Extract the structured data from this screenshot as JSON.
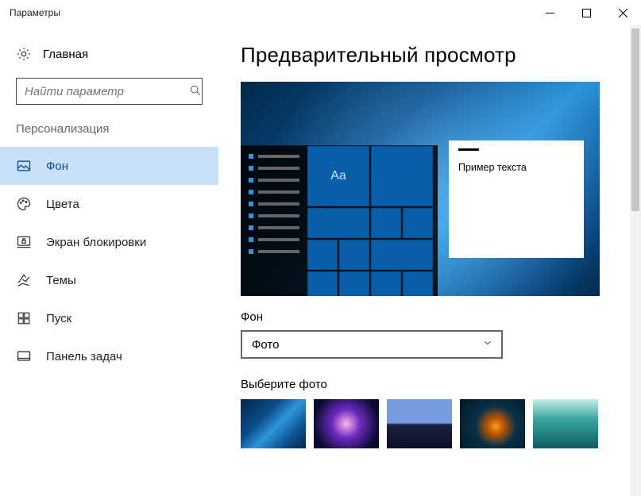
{
  "window": {
    "title": "Параметры"
  },
  "sidebar": {
    "home": "Главная",
    "search_placeholder": "Найти параметр",
    "section": "Персонализация",
    "items": [
      {
        "label": "Фон",
        "icon": "picture-icon",
        "active": true
      },
      {
        "label": "Цвета",
        "icon": "palette-icon"
      },
      {
        "label": "Экран блокировки",
        "icon": "lockscreen-icon"
      },
      {
        "label": "Темы",
        "icon": "themes-icon"
      },
      {
        "label": "Пуск",
        "icon": "start-icon"
      },
      {
        "label": "Панель задач",
        "icon": "taskbar-icon"
      }
    ]
  },
  "main": {
    "heading": "Предварительный просмотр",
    "sample_text": "Пример текста",
    "tile_text": "Aa",
    "bg_label": "Фон",
    "bg_value": "Фото",
    "choose_label": "Выберите фото",
    "thumbs": [
      "win10",
      "nebula",
      "beach",
      "cave",
      "sea"
    ]
  }
}
